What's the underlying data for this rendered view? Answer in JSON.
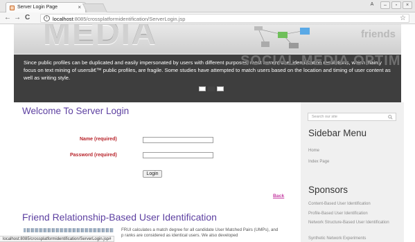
{
  "browser": {
    "tab_title": "Server Login Page",
    "tab_close": "×",
    "url_host": "localhost",
    "url_path": ":8085/crossplatformidentification/ServerLogin.jsp",
    "nav_back": "←",
    "nav_forward": "→",
    "nav_reload": "C",
    "info_glyph": "i",
    "star_glyph": "☆",
    "win_user": "A",
    "win_min": "–",
    "win_max": "▫",
    "win_close": "×"
  },
  "banner": {
    "word_media": "MEDIA",
    "word_friends": "friends",
    "word_social": "SOCIAL MEDIA OPTIMI",
    "text": "Since public profiles can be duplicated and easily impersonated by users with different purposes, most current user identification resolutions, which mainly focus on text mining of usersâ€™ public profiles, are fragile. Some studies have attempted to match users based on the location and timing of user content as well as writing style.",
    "slider_count": 3,
    "slider_active": 1
  },
  "main": {
    "welcome_title": "Welcome To Server Login",
    "name_label": "Name (required)",
    "password_label": "Password (required)",
    "name_value": "",
    "password_value": "",
    "login_button": "Login",
    "back_link": "Back",
    "section_title": "Friend Relationship-Based User Identification",
    "para_line1": "FRUI calculates a match degree for all candidate User Matched Pairs (UMPs), and",
    "para_line2": "p ranks are considered as identical users. We also developed"
  },
  "sidebar": {
    "search_placeholder": "Search our site",
    "menu_title": "Sidebar Menu",
    "menu_items": [
      "Home",
      "Index Page"
    ],
    "sponsors_title": "Sponsors",
    "sponsor_items": [
      "Content-Based User Identification",
      "Profile-Based User Identification",
      "Network Structure-Based User Identification",
      "Synthetic Network Experiments"
    ]
  },
  "status_url": "localhost:8085/crossplatformidentification/ServerLogin.jsp#",
  "colors": {
    "heading_purple": "#5c3fa0",
    "label_red": "#b8232a",
    "link_pink": "#c43aa1",
    "sidebar_bg": "#f0f0f0",
    "overlay_bg": "#2d2d2d"
  },
  "icons": [
    "favicon-icon",
    "back-arrow-icon",
    "forward-arrow-icon",
    "reload-icon",
    "info-icon",
    "bookmark-star-icon",
    "search-icon"
  ]
}
